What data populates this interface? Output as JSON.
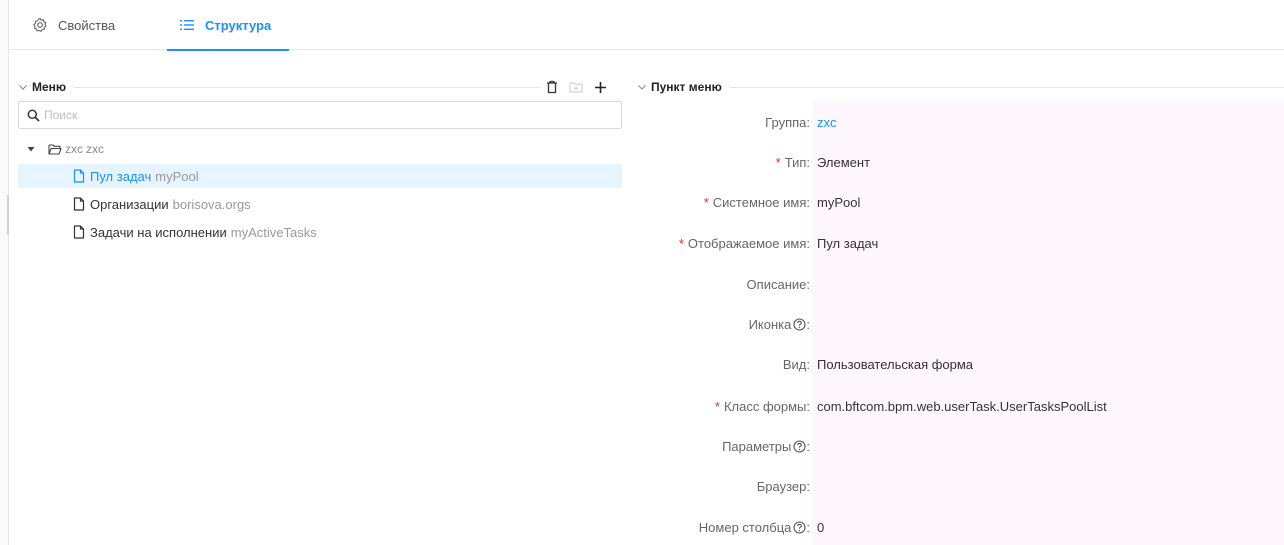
{
  "tabs": [
    {
      "label": "Свойства",
      "icon": "gear-icon",
      "active": false
    },
    {
      "label": "Структура",
      "icon": "list-icon",
      "active": true
    }
  ],
  "menu_panel": {
    "title": "Меню",
    "actions": [
      "trash-icon",
      "folder-add-icon",
      "plus-icon"
    ],
    "search_placeholder": "Поиск",
    "tree": {
      "root": {
        "name": "zxc",
        "sub": "zxc"
      },
      "items": [
        {
          "name": "Пул задач",
          "sub": "myPool",
          "selected": true
        },
        {
          "name": "Организации",
          "sub": "borisova.orgs",
          "selected": false
        },
        {
          "name": "Задачи на исполнении",
          "sub": "myActiveTasks",
          "selected": false
        }
      ]
    }
  },
  "item_panel": {
    "title": "Пункт меню",
    "fields": [
      {
        "label": "Группа",
        "required": false,
        "help": false,
        "value": "zxc",
        "link": true
      },
      {
        "label": "Тип",
        "required": true,
        "help": false,
        "value": "Элемент"
      },
      {
        "label": "Системное имя",
        "required": true,
        "help": false,
        "value": "myPool"
      },
      {
        "label": "Отображаемое имя",
        "required": true,
        "help": false,
        "value": "Пул задач"
      },
      {
        "label": "Описание",
        "required": false,
        "help": false,
        "value": ""
      },
      {
        "label": "Иконка",
        "required": false,
        "help": true,
        "value": ""
      },
      {
        "label": "Вид",
        "required": false,
        "help": false,
        "value": "Пользовательская форма"
      },
      {
        "label": "Класс формы",
        "required": true,
        "help": false,
        "value": "com.bftcom.bpm.web.userTask.UserTasksPoolList"
      },
      {
        "label": "Параметры",
        "required": false,
        "help": true,
        "value": ""
      },
      {
        "label": "Браузер",
        "required": false,
        "help": false,
        "value": ""
      },
      {
        "label": "Номер столбца",
        "required": false,
        "help": true,
        "value": "0"
      }
    ]
  },
  "colors": {
    "accent": "#1890ff",
    "required": "#f5222d",
    "selected_bg": "#e6f4ff",
    "field_bg": "#fdf7fb"
  }
}
